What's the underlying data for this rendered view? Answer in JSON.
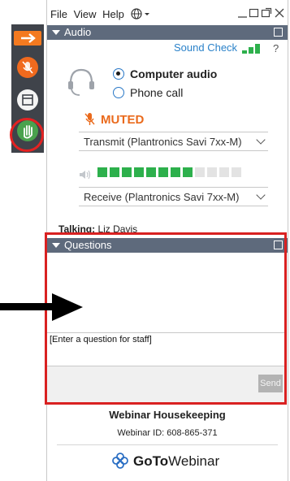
{
  "menu": {
    "file": "File",
    "view": "View",
    "help": "Help",
    "globe_icon": "globe-icon"
  },
  "audio": {
    "header": "Audio",
    "sound_check": "Sound Check",
    "help": "?",
    "options": [
      {
        "label": "Computer audio",
        "selected": true
      },
      {
        "label": "Phone call",
        "selected": false
      }
    ],
    "status": "MUTED",
    "transmit_device": "Transmit (Plantronics Savi 7xx-M)",
    "receive_device": "Receive (Plantronics Savi 7xx-M)",
    "level_meter": {
      "filled": 8,
      "total": 12
    },
    "talking_label": "Talking:",
    "talking_name": "Liz Davis"
  },
  "questions": {
    "header": "Questions",
    "input_placeholder": "[Enter a question for staff]",
    "send_label": "Send"
  },
  "footer": {
    "title": "Webinar Housekeeping",
    "webinar_id": "Webinar ID: 608-865-371",
    "brand_goto": "GoTo",
    "brand_webinar": "Webinar"
  },
  "colors": {
    "accent_orange": "#f47a20",
    "header_bar": "#5e6a7c",
    "signal_green": "#2db04c",
    "highlight_red": "#d92121"
  }
}
